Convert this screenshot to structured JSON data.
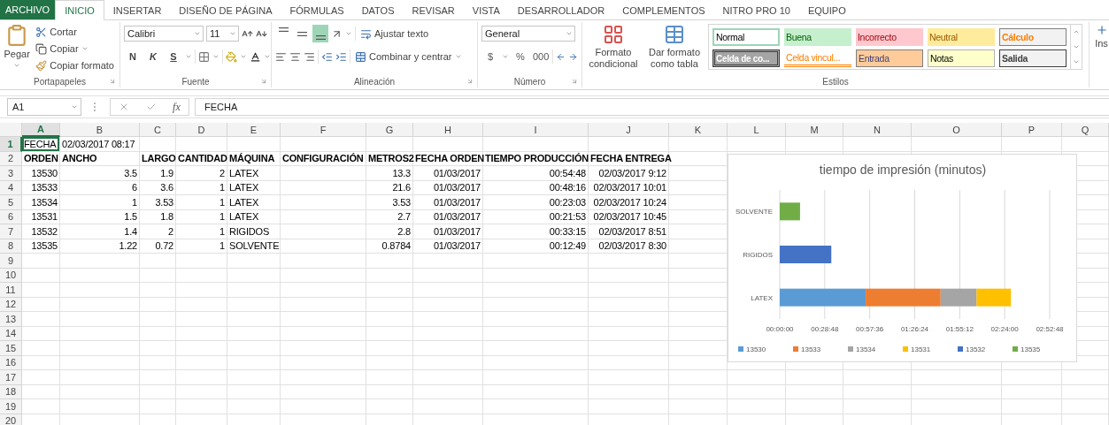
{
  "ribbon_tabs": [
    {
      "label": "ARCHIVO",
      "kind": "file",
      "selected": false
    },
    {
      "label": "INICIO",
      "kind": "tab",
      "selected": true
    },
    {
      "label": "INSERTAR",
      "kind": "tab",
      "selected": false
    },
    {
      "label": "DISEÑO DE PÁGINA",
      "kind": "tab",
      "selected": false
    },
    {
      "label": "FÓRMULAS",
      "kind": "tab",
      "selected": false
    },
    {
      "label": "DATOS",
      "kind": "tab",
      "selected": false
    },
    {
      "label": "REVISAR",
      "kind": "tab",
      "selected": false
    },
    {
      "label": "VISTA",
      "kind": "tab",
      "selected": false
    },
    {
      "label": "DESARROLLADOR",
      "kind": "tab",
      "selected": false
    },
    {
      "label": "COMPLEMENTOS",
      "kind": "tab",
      "selected": false
    },
    {
      "label": "NITRO PRO 10",
      "kind": "tab",
      "selected": false
    },
    {
      "label": "EQUIPO",
      "kind": "tab",
      "selected": false
    }
  ],
  "clipboard": {
    "paste": "Pegar",
    "cut": "Cortar",
    "copy": "Copiar",
    "format_painter": "Copiar formato",
    "label": "Portapapeles"
  },
  "font": {
    "name": "Calibri",
    "size": "11",
    "bold": "N",
    "italic": "K",
    "underline": "S",
    "label": "Fuente"
  },
  "alignment": {
    "vertical": [
      {
        "selected": false
      },
      {
        "selected": false
      },
      {
        "selected": true
      }
    ],
    "wrap": "Ajustar texto",
    "merge": "Combinar y centrar",
    "label": "Alineación"
  },
  "number": {
    "format": "General",
    "currency": "$",
    "percent": "%",
    "thousands": "000",
    "label": "Número"
  },
  "styles": {
    "conditional": "Formato condicional",
    "as_table": "Dar formato como tabla",
    "label": "Estilos",
    "cells": [
      {
        "label": "Normal",
        "kind": "normal"
      },
      {
        "label": "Buena",
        "kind": "good"
      },
      {
        "label": "Incorrecto",
        "kind": "bad"
      },
      {
        "label": "Neutral",
        "kind": "neutral"
      },
      {
        "label": "Cálculo",
        "kind": "calculation"
      },
      {
        "label": "Celda de co...",
        "kind": "check"
      },
      {
        "label": "Celda vincul...",
        "kind": "linked"
      },
      {
        "label": "Entrada",
        "kind": "input"
      },
      {
        "label": "Notas",
        "kind": "note"
      },
      {
        "label": "Salida",
        "kind": "output"
      }
    ]
  },
  "cells_group": {
    "insert": "Ins"
  },
  "formula_bar": {
    "name_box": "A1",
    "fx": "fx",
    "value": "FECHA"
  },
  "sheet": {
    "columns": [
      {
        "label": "A",
        "selected": true,
        "kind": "number"
      },
      {
        "label": "B",
        "selected": false,
        "kind": "number"
      },
      {
        "label": "C",
        "selected": false,
        "kind": "number"
      },
      {
        "label": "D",
        "selected": false,
        "kind": "number"
      },
      {
        "label": "E",
        "selected": false,
        "kind": "text"
      },
      {
        "label": "F",
        "selected": false,
        "kind": "text"
      },
      {
        "label": "G",
        "selected": false,
        "kind": "number"
      },
      {
        "label": "H",
        "selected": false,
        "kind": "number"
      },
      {
        "label": "I",
        "selected": false,
        "kind": "number"
      },
      {
        "label": "J",
        "selected": false,
        "kind": "number"
      },
      {
        "label": "K",
        "selected": false,
        "kind": "text"
      },
      {
        "label": "L",
        "selected": false,
        "kind": "text"
      },
      {
        "label": "M",
        "selected": false,
        "kind": "text"
      },
      {
        "label": "N",
        "selected": false,
        "kind": "text"
      },
      {
        "label": "O",
        "selected": false,
        "kind": "text"
      },
      {
        "label": "P",
        "selected": false,
        "kind": "text"
      },
      {
        "label": "Q",
        "selected": false,
        "kind": "text"
      }
    ],
    "rows": [
      {
        "number": "1",
        "selected": true,
        "kind": "text",
        "cells": [
          "FECHA",
          "02/03/2017 08:17"
        ]
      },
      {
        "number": "2",
        "selected": false,
        "kind": "header",
        "cells": [
          "ORDEN",
          "ANCHO",
          "LARGO",
          "CANTIDAD",
          "MÁQUINA",
          "CONFIGURACIÓN",
          "METROS2",
          "FECHA ORDEN",
          "TIEMPO PRODUCCIÓN",
          "FECHA ENTREGA"
        ]
      },
      {
        "number": "3",
        "selected": false,
        "kind": "data",
        "cells": [
          "13530",
          "3.5",
          "1.9",
          "2",
          "LATEX",
          "",
          "13.3",
          "01/03/2017",
          "00:54:48",
          "02/03/2017 9:12"
        ]
      },
      {
        "number": "4",
        "selected": false,
        "kind": "data",
        "cells": [
          "13533",
          "6",
          "3.6",
          "1",
          "LATEX",
          "",
          "21.6",
          "01/03/2017",
          "00:48:16",
          "02/03/2017 10:01"
        ]
      },
      {
        "number": "5",
        "selected": false,
        "kind": "data",
        "cells": [
          "13534",
          "1",
          "3.53",
          "1",
          "LATEX",
          "",
          "3.53",
          "01/03/2017",
          "00:23:03",
          "02/03/2017 10:24"
        ]
      },
      {
        "number": "6",
        "selected": false,
        "kind": "data",
        "cells": [
          "13531",
          "1.5",
          "1.8",
          "1",
          "LATEX",
          "",
          "2.7",
          "01/03/2017",
          "00:21:53",
          "02/03/2017 10:45"
        ]
      },
      {
        "number": "7",
        "selected": false,
        "kind": "data",
        "cells": [
          "13532",
          "1.4",
          "2",
          "1",
          "RIGIDOS",
          "",
          "2.8",
          "01/03/2017",
          "00:33:15",
          "02/03/2017 8:51"
        ]
      },
      {
        "number": "8",
        "selected": false,
        "kind": "data",
        "cells": [
          "13535",
          "1.22",
          "0.72",
          "1",
          "SOLVENTE",
          "",
          "0.8784",
          "01/03/2017",
          "00:12:49",
          "02/03/2017 8:30"
        ]
      },
      {
        "number": "9",
        "selected": false,
        "kind": "data"
      },
      {
        "number": "10",
        "selected": false,
        "kind": "data"
      },
      {
        "number": "11",
        "selected": false,
        "kind": "data"
      },
      {
        "number": "12",
        "selected": false,
        "kind": "data"
      },
      {
        "number": "13",
        "selected": false,
        "kind": "data"
      },
      {
        "number": "14",
        "selected": false,
        "kind": "data"
      },
      {
        "number": "15",
        "selected": false,
        "kind": "data"
      },
      {
        "number": "16",
        "selected": false,
        "kind": "data"
      },
      {
        "number": "17",
        "selected": false,
        "kind": "data"
      },
      {
        "number": "18",
        "selected": false,
        "kind": "data"
      },
      {
        "number": "19",
        "selected": false,
        "kind": "data"
      },
      {
        "number": "20",
        "selected": false,
        "kind": "data"
      }
    ],
    "chart": {
      "chart_data": {
        "type": "bar",
        "orientation": "horizontal",
        "stacked": true,
        "title": "tiempo de impresión (minutos)",
        "categories": [
          "SOLVENTE",
          "RIGIDOS",
          "LATEX"
        ],
        "grid": true,
        "legend": "bottom",
        "series": [
          {
            "name": "13530",
            "color": "#5b9bd5",
            "values": [
              null,
              null,
              55
            ]
          },
          {
            "name": "13533",
            "color": "#ed7d31",
            "values": [
              null,
              null,
              48
            ]
          },
          {
            "name": "13534",
            "color": "#a5a5a5",
            "values": [
              null,
              null,
              23
            ]
          },
          {
            "name": "13531",
            "color": "#ffc000",
            "values": [
              null,
              null,
              22
            ]
          },
          {
            "name": "13532",
            "color": "#4472c4",
            "values": [
              null,
              33,
              null
            ]
          },
          {
            "name": "13535",
            "color": "#70ad47",
            "values": [
              13,
              null,
              null
            ]
          }
        ],
        "xlim": [
          0,
          172.8
        ],
        "xticks": [
          {
            "value": 0,
            "label": "00:00:00"
          },
          {
            "value": 28.8,
            "label": "00:28:48"
          },
          {
            "value": 57.6,
            "label": "00:57:36"
          },
          {
            "value": 86.4,
            "label": "01:26:24"
          },
          {
            "value": 115.2,
            "label": "01:55:12"
          },
          {
            "value": 144,
            "label": "02:24:00"
          },
          {
            "value": 172.8,
            "label": "02:52:48"
          }
        ]
      }
    }
  }
}
